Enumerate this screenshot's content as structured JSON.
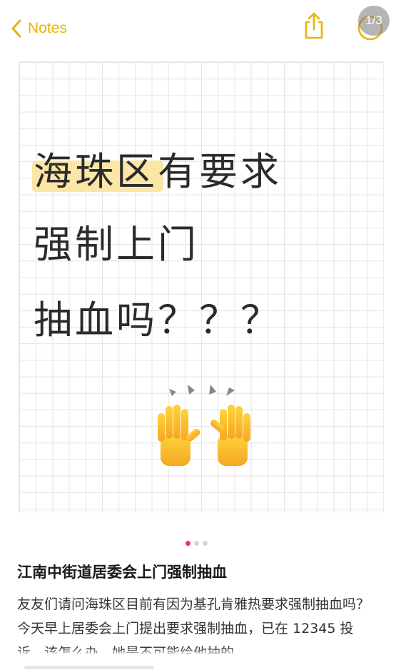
{
  "nav": {
    "back_label": "Notes",
    "page_indicator": "1/3",
    "accent_color": "#e9b308",
    "icons": [
      "chevron-left-icon",
      "share-icon",
      "more-icon"
    ]
  },
  "note_image": {
    "line1_highlighted": "海珠区",
    "line1_rest": "有要求",
    "line2": "强制上门",
    "line3": "抽血吗？？？",
    "emoji": "raising-hands-icon"
  },
  "pager": {
    "total": 3,
    "active_index": 0,
    "active_color": "#ff2d46"
  },
  "post": {
    "title": "江南中街道居委会上门强制抽血",
    "body": "友友们请问海珠区目前有因为基孔肯雅热要求强制抽血吗？今天早上居委会上门提出要求强制抽血，已在 12345 投诉，该怎么办，她是不可能给他抽的"
  }
}
